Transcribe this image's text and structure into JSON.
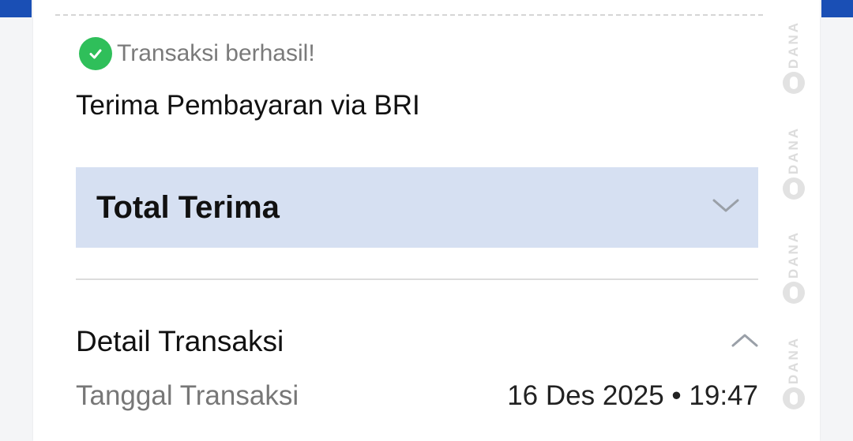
{
  "status": {
    "text": "Transaksi berhasil!",
    "icon": "check-circle-icon",
    "color": "#2fbf5a"
  },
  "title": "Terima Pembayaran via BRI",
  "total": {
    "label": "Total Terima",
    "icon": "chevron-down-icon",
    "background": "#d6e0f2"
  },
  "detail": {
    "title": "Detail Transaksi",
    "icon": "chevron-up-icon",
    "rows": [
      {
        "label": "Tanggal Transaksi",
        "value": "16 Des 2025 • 19:47"
      }
    ]
  },
  "watermark": {
    "text": "DANA",
    "icon": "dana-logo-icon"
  },
  "colors": {
    "accent": "#1a4fb5"
  }
}
